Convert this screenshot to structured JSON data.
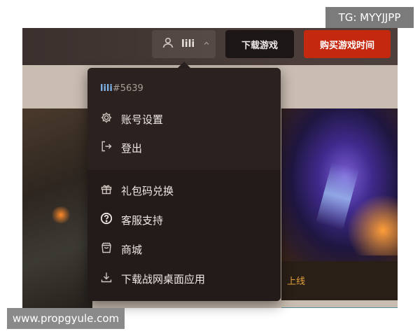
{
  "watermarks": {
    "tg": "TG: MYYJJPP",
    "url": "www.propgyule.com"
  },
  "header": {
    "user": {
      "name": "lili",
      "icon": "user-icon",
      "chevron": "chevron-up-icon"
    },
    "download_label": "下载游戏",
    "buy_label": "购买游戏时间"
  },
  "promo": {
    "text": "上线"
  },
  "menu": {
    "user_handle": "lili",
    "user_tag": "#5639",
    "items": [
      {
        "label": "账号设置",
        "icon": "gear-icon"
      },
      {
        "label": "登出",
        "icon": "logout-icon"
      },
      {
        "label": "礼包码兑换",
        "icon": "gift-icon"
      },
      {
        "label": "客服支持",
        "icon": "help-circle-icon"
      },
      {
        "label": "商城",
        "icon": "shopping-bag-icon"
      },
      {
        "label": "下载战网桌面应用",
        "icon": "download-icon"
      }
    ]
  },
  "colors": {
    "accent": "#c4290f",
    "menu_bg": "#2b2220",
    "handle": "#7fb4e8",
    "promo": "#e3a33a"
  }
}
